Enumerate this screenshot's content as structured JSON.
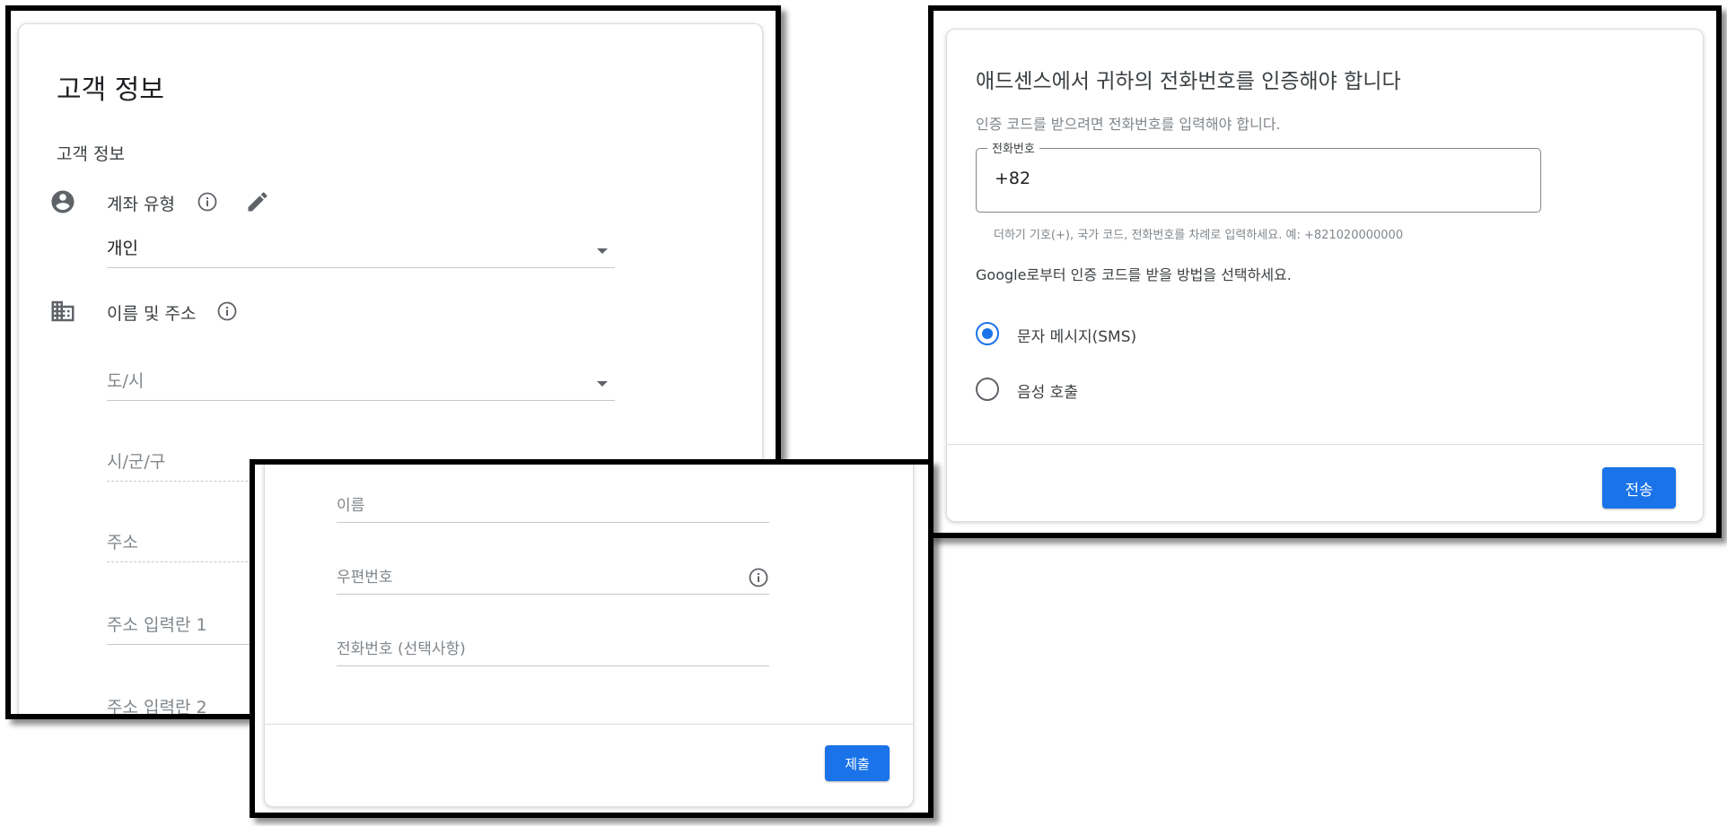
{
  "customer_panel": {
    "title": "고객 정보",
    "section_label": "고객 정보",
    "account_type": {
      "label": "계좌 유형",
      "value": "개인",
      "icon": "person-icon",
      "info_icon": "info-icon",
      "edit_icon": "edit-icon"
    },
    "name_address": {
      "label": "이름 및 주소",
      "icon": "business-icon",
      "info_icon": "info-icon"
    },
    "fields": {
      "province": "도/시",
      "city": "시/군/구",
      "address": "주소",
      "address_line1": "주소 입력란 1",
      "address_line2": "주소 입력란 2"
    }
  },
  "form_panel": {
    "name_field": "이름",
    "postal_field": "우편번호",
    "phone_field": "전화번호 (선택사항)",
    "submit_label": "제출"
  },
  "verify_panel": {
    "title": "애드센스에서 귀하의 전화번호를 인증해야 합니다",
    "description": "인증 코드를 받으려면 전화번호를 입력해야 합니다.",
    "phone_label": "전화번호",
    "phone_value": "+82",
    "hint": "더하기 기호(+), 국가 코드, 전화번호를 차례로 입력하세요. 예: +821020000000",
    "method_prompt": "Google로부터 인증 코드를 받을 방법을 선택하세요.",
    "options": [
      {
        "label": "문자 메시지(SMS)",
        "selected": true
      },
      {
        "label": "음성 호출",
        "selected": false
      }
    ],
    "send_label": "전송"
  },
  "colors": {
    "primary": "#1a73e8",
    "border": "#000000",
    "divider": "#dadce0"
  }
}
